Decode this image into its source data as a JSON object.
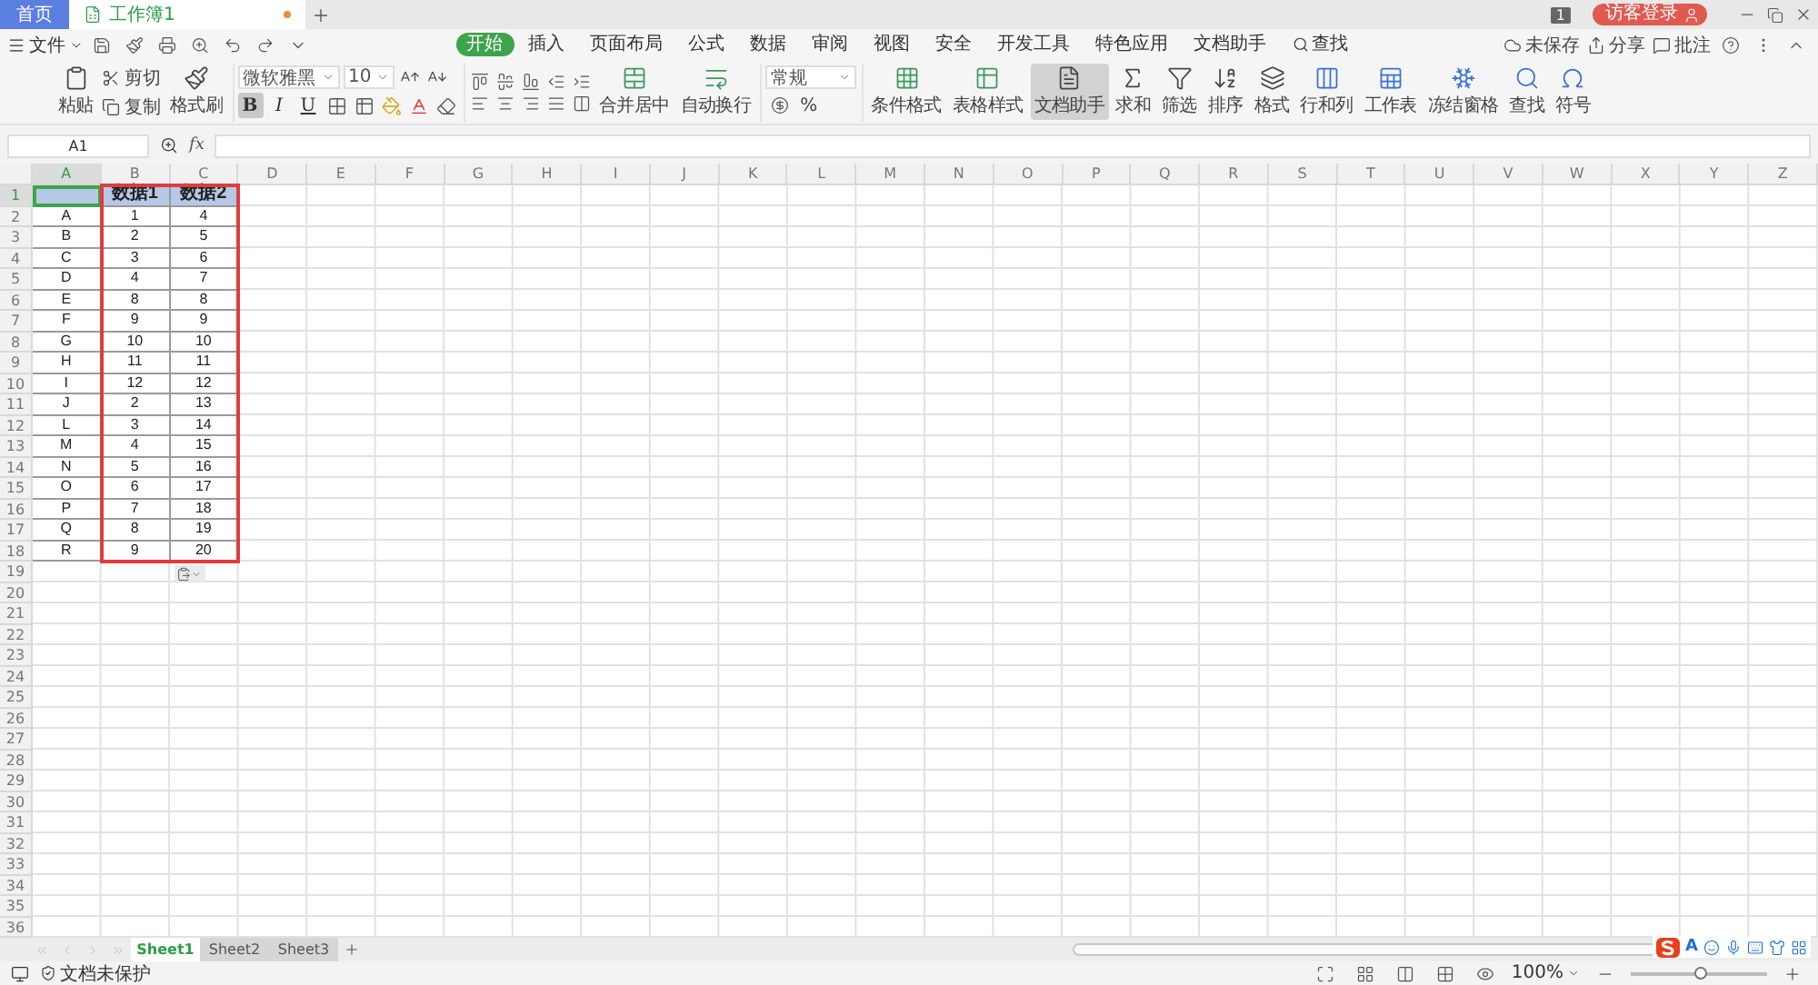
{
  "title_bar": {
    "tabs": [
      {
        "label": "首页",
        "kind": "home",
        "selected": false
      },
      {
        "label": "工作簿1",
        "kind": "doc",
        "selected": true,
        "unsaved": true
      }
    ],
    "badge": "1",
    "login": "访客登录"
  },
  "menu_bar": {
    "file": "文件",
    "tabs": [
      {
        "label": "开始",
        "selected": true
      },
      {
        "label": "插入",
        "selected": false
      },
      {
        "label": "页面布局",
        "selected": false
      },
      {
        "label": "公式",
        "selected": false
      },
      {
        "label": "数据",
        "selected": false
      },
      {
        "label": "审阅",
        "selected": false
      },
      {
        "label": "视图",
        "selected": false
      },
      {
        "label": "安全",
        "selected": false
      },
      {
        "label": "开发工具",
        "selected": false
      },
      {
        "label": "特色应用",
        "selected": false
      },
      {
        "label": "文档助手",
        "selected": false
      },
      {
        "label": "查找",
        "selected": false,
        "kind": "search"
      }
    ],
    "actions": [
      {
        "label": "未保存",
        "kind": "cloud"
      },
      {
        "label": "分享",
        "kind": "share"
      },
      {
        "label": "批注",
        "kind": "comment"
      }
    ]
  },
  "ribbon": {
    "paste": "粘贴",
    "cut": "剪切",
    "copy": "复制",
    "format_painter": "格式刷",
    "font_family": "微软雅黑",
    "font_size": "10",
    "styles": [
      {
        "label": "B",
        "selected": true
      },
      {
        "label": "I",
        "selected": false
      },
      {
        "label": "U",
        "selected": false
      }
    ],
    "merge": "合并居中",
    "wrap": "自动换行",
    "number_format": "常规",
    "percent": "%",
    "tools": [
      {
        "label": "条件格式",
        "selected": false
      },
      {
        "label": "表格样式",
        "selected": false
      },
      {
        "label": "文档助手",
        "selected": true
      },
      {
        "label": "求和",
        "selected": false
      },
      {
        "label": "筛选",
        "selected": false
      },
      {
        "label": "排序",
        "selected": false
      },
      {
        "label": "格式",
        "selected": false
      },
      {
        "label": "行和列",
        "selected": false
      },
      {
        "label": "工作表",
        "selected": false
      },
      {
        "label": "冻结窗格",
        "selected": false
      },
      {
        "label": "查找",
        "selected": false
      },
      {
        "label": "符号",
        "selected": false
      }
    ]
  },
  "formula_bar": {
    "name_box": "A1",
    "fx": "fx"
  },
  "sheet": {
    "columns": [
      {
        "label": "A",
        "selected": true
      },
      {
        "label": "B",
        "selected": false
      },
      {
        "label": "C",
        "selected": false
      },
      {
        "label": "D",
        "selected": false
      },
      {
        "label": "E",
        "selected": false
      },
      {
        "label": "F",
        "selected": false
      },
      {
        "label": "G",
        "selected": false
      },
      {
        "label": "H",
        "selected": false
      },
      {
        "label": "I",
        "selected": false
      },
      {
        "label": "J",
        "selected": false
      },
      {
        "label": "K",
        "selected": false
      },
      {
        "label": "L",
        "selected": false
      },
      {
        "label": "M",
        "selected": false
      },
      {
        "label": "N",
        "selected": false
      },
      {
        "label": "O",
        "selected": false
      },
      {
        "label": "P",
        "selected": false
      },
      {
        "label": "Q",
        "selected": false
      },
      {
        "label": "R",
        "selected": false
      },
      {
        "label": "S",
        "selected": false
      },
      {
        "label": "T",
        "selected": false
      },
      {
        "label": "U",
        "selected": false
      },
      {
        "label": "V",
        "selected": false
      },
      {
        "label": "W",
        "selected": false
      },
      {
        "label": "X",
        "selected": false
      },
      {
        "label": "Y",
        "selected": false
      },
      {
        "label": "Z",
        "selected": false
      }
    ],
    "row_numbers": [
      "1",
      "2",
      "3",
      "4",
      "5",
      "6",
      "7",
      "8",
      "9",
      "10",
      "11",
      "12",
      "13",
      "14",
      "15",
      "16",
      "17",
      "18",
      "19",
      "20",
      "21",
      "22",
      "23",
      "24",
      "25",
      "26",
      "27",
      "28",
      "29",
      "30",
      "31",
      "32",
      "33",
      "34",
      "35",
      "36"
    ],
    "rows": [
      {
        "kind": "header",
        "cells": [
          {
            "active": true
          },
          {
            "text": "数据1"
          },
          {
            "text": "数据2"
          }
        ]
      },
      {
        "kind": "data",
        "cells": [
          {
            "text": "A"
          },
          {
            "text": "1"
          },
          {
            "text": "4"
          }
        ]
      },
      {
        "kind": "data",
        "cells": [
          {
            "text": "B"
          },
          {
            "text": "2"
          },
          {
            "text": "5"
          }
        ]
      },
      {
        "kind": "data",
        "cells": [
          {
            "text": "C"
          },
          {
            "text": "3"
          },
          {
            "text": "6"
          }
        ]
      },
      {
        "kind": "data",
        "cells": [
          {
            "text": "D"
          },
          {
            "text": "4"
          },
          {
            "text": "7"
          }
        ]
      },
      {
        "kind": "data",
        "cells": [
          {
            "text": "E"
          },
          {
            "text": "8"
          },
          {
            "text": "8"
          }
        ]
      },
      {
        "kind": "data",
        "cells": [
          {
            "text": "F"
          },
          {
            "text": "9"
          },
          {
            "text": "9"
          }
        ]
      },
      {
        "kind": "data",
        "cells": [
          {
            "text": "G"
          },
          {
            "text": "10"
          },
          {
            "text": "10"
          }
        ]
      },
      {
        "kind": "data",
        "cells": [
          {
            "text": "H"
          },
          {
            "text": "11"
          },
          {
            "text": "11"
          }
        ]
      },
      {
        "kind": "data",
        "cells": [
          {
            "text": "I"
          },
          {
            "text": "12"
          },
          {
            "text": "12"
          }
        ]
      },
      {
        "kind": "data",
        "cells": [
          {
            "text": "J"
          },
          {
            "text": "2"
          },
          {
            "text": "13"
          }
        ]
      },
      {
        "kind": "data",
        "cells": [
          {
            "text": "L"
          },
          {
            "text": "3"
          },
          {
            "text": "14"
          }
        ]
      },
      {
        "kind": "data",
        "cells": [
          {
            "text": "M"
          },
          {
            "text": "4"
          },
          {
            "text": "15"
          }
        ]
      },
      {
        "kind": "data",
        "cells": [
          {
            "text": "N"
          },
          {
            "text": "5"
          },
          {
            "text": "16"
          }
        ]
      },
      {
        "kind": "data",
        "cells": [
          {
            "text": "O"
          },
          {
            "text": "6"
          },
          {
            "text": "17"
          }
        ]
      },
      {
        "kind": "data",
        "cells": [
          {
            "text": "P"
          },
          {
            "text": "7"
          },
          {
            "text": "18"
          }
        ]
      },
      {
        "kind": "data",
        "cells": [
          {
            "text": "Q"
          },
          {
            "text": "8"
          },
          {
            "text": "19"
          }
        ]
      },
      {
        "kind": "data",
        "cells": [
          {
            "text": "R"
          },
          {
            "text": "9"
          },
          {
            "text": "20"
          }
        ]
      }
    ],
    "highlight_box": true,
    "paste_options": true
  },
  "sheet_tabs": [
    {
      "label": "Sheet1",
      "selected": true
    },
    {
      "label": "Sheet2",
      "selected": false
    },
    {
      "label": "Sheet3",
      "selected": false
    }
  ],
  "status_bar": {
    "protection": "文档未保护",
    "zoom": "100%",
    "zoom_slider": {
      "level": 0.5
    },
    "ime_mode": "A"
  }
}
